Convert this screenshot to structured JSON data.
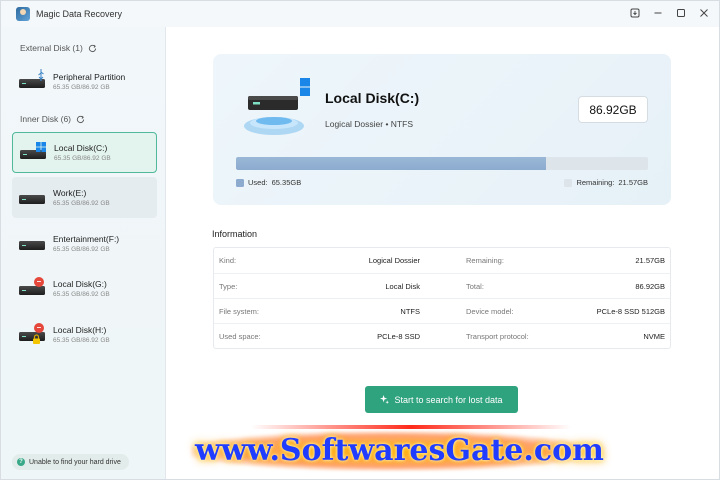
{
  "app": {
    "title": "Magic Data Recovery"
  },
  "sidebar": {
    "external_header": "External Disk (1)",
    "inner_header": "Inner Disk (6)",
    "external_disks": [
      {
        "name": "Peripheral Partition",
        "size": "65.35 GB/86.92 GB"
      }
    ],
    "inner_disks": [
      {
        "name": "Local Disk(C:)",
        "size": "65.35 GB/86.92 GB"
      },
      {
        "name": "Work(E:)",
        "size": "65.35 GB/86.92 GB"
      },
      {
        "name": "Entertainment(F:)",
        "size": "65.35 GB/86.92 GB"
      },
      {
        "name": "Local Disk(G:)",
        "size": "65.35 GB/86.92 GB"
      },
      {
        "name": "Local Disk(H:)",
        "size": "65.35 GB/86.92 GB"
      }
    ],
    "help_text": "Unable to find your hard drive"
  },
  "disk_card": {
    "title": "Local Disk(C:)",
    "subtitle": "Logical Dossier • NTFS",
    "total_size": "86.92GB",
    "used_label": "Used:",
    "used_value": "65.35GB",
    "remaining_label": "Remaining:",
    "remaining_value": "21.57GB",
    "used_fraction": 0.752
  },
  "information": {
    "title": "Information",
    "rows": [
      {
        "l1": "Kind:",
        "v1": "Logical Dossier",
        "l2": "Remaining:",
        "v2": "21.57GB"
      },
      {
        "l1": "Type:",
        "v1": "Local Disk",
        "l2": "Total:",
        "v2": "86.92GB"
      },
      {
        "l1": "File system:",
        "v1": "NTFS",
        "l2": "Device model:",
        "v2": "PCLe-8 SSD 512GB"
      },
      {
        "l1": "Used space:",
        "v1": "PCLe-8 SSD",
        "l2": "Transport protocol:",
        "v2": "NVME"
      }
    ]
  },
  "actions": {
    "search_label": "Start to search for lost data"
  },
  "watermark": {
    "text": "www.SoftwaresGate.com"
  },
  "colors": {
    "accent": "#2fa27e",
    "selected_border": "#4fb99a",
    "progress_fill": "#8cabcf",
    "error_badge": "#e5483b"
  }
}
